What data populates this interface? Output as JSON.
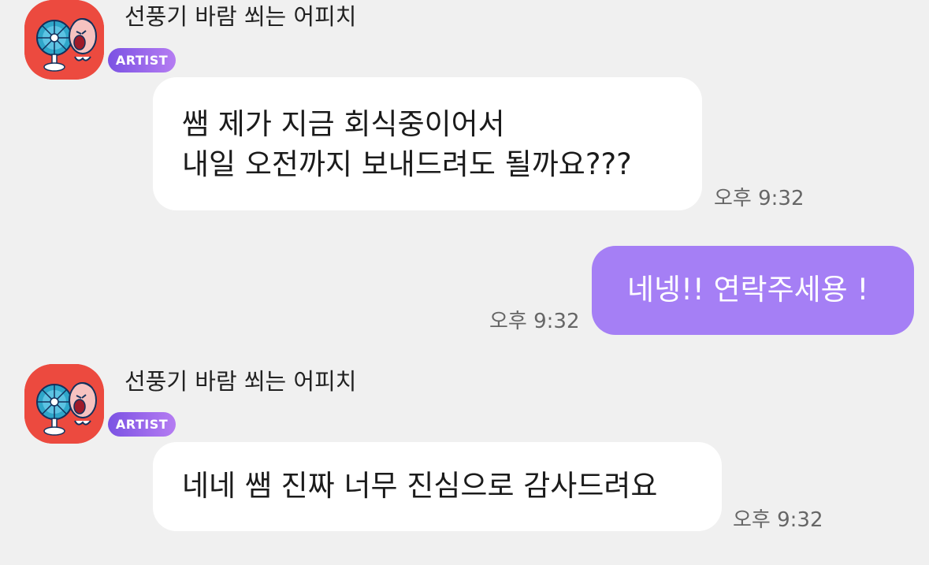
{
  "colors": {
    "background": "#f0f0f0",
    "incoming_bubble": "#ffffff",
    "outgoing_bubble": "#a57ff5",
    "badge_gradient_start": "#7b52e3",
    "badge_gradient_end": "#b57cf2",
    "avatar_background": "#ec4a3f"
  },
  "messages": [
    {
      "direction": "incoming",
      "sender": "선풍기 바람 쐬는 어피치",
      "badge": "ARTIST",
      "avatar_icon": "apeach-fan-icon",
      "lines": [
        "쌤 제가 지금 회식중이어서",
        "내일 오전까지 보내드려도 될까요???"
      ],
      "time": "오후 9:32"
    },
    {
      "direction": "outgoing",
      "lines": [
        "네넹!! 연락주세용 !"
      ],
      "time": "오후 9:32"
    },
    {
      "direction": "incoming",
      "sender": "선풍기 바람 쐬는 어피치",
      "badge": "ARTIST",
      "avatar_icon": "apeach-fan-icon",
      "lines": [
        "네네 쌤 진짜 너무 진심으로 감사드려요"
      ],
      "time": "오후 9:32"
    }
  ]
}
